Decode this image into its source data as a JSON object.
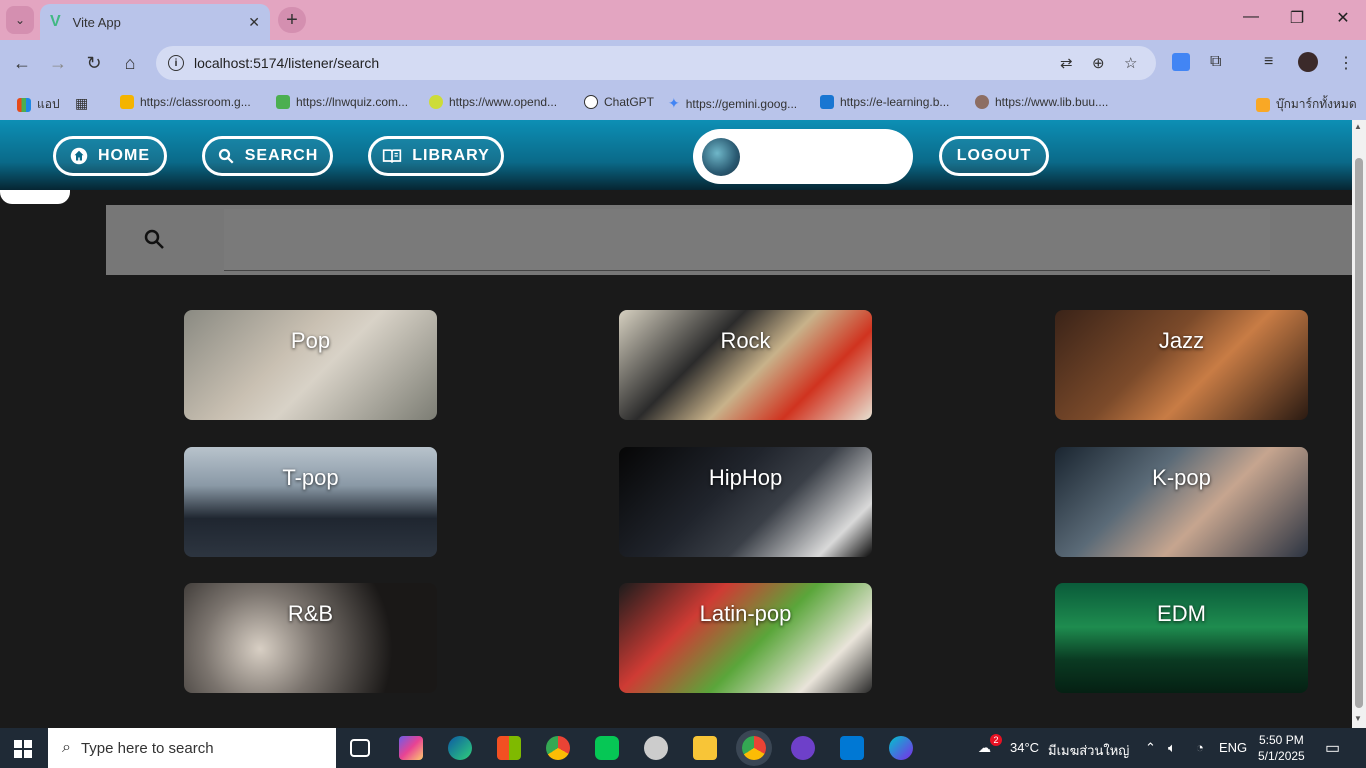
{
  "browser": {
    "tab_title": "Vite App",
    "url": "localhost:5174/listener/search",
    "bookmarks": [
      {
        "label": "แอป",
        "color": "#e64a19"
      },
      {
        "label": "https://classroom.g...",
        "color": "#f4b400"
      },
      {
        "label": "https://lnwquiz.com...",
        "color": "#4caf50"
      },
      {
        "label": "https://www.opend...",
        "color": "#cddc39"
      },
      {
        "label": "ChatGPT",
        "color": "#ffffff"
      },
      {
        "label": "https://gemini.goog...",
        "color": "#4285f4"
      },
      {
        "label": "https://e-learning.b...",
        "color": "#1976d2"
      },
      {
        "label": "https://www.lib.buu....",
        "color": "#8d6e63"
      },
      {
        "label": "บุ๊กมาร์กทั้งหมด",
        "color": "#f9a825"
      }
    ]
  },
  "nav": {
    "home": "HOME",
    "search": "SEARCH",
    "library": "LIBRARY",
    "logout": "LOGOUT"
  },
  "search": {
    "placeholder": ""
  },
  "genres": [
    {
      "label": "Pop",
      "bg": "linear-gradient(135deg,#8a8a82 0%,#c9c0b2 40%,#d8d2c7 55%,#7c7d74 100%)"
    },
    {
      "label": "Rock",
      "bg": "linear-gradient(135deg,#d6d0c0 0%,#2b2b2b 35%,#c8b28a 55%,#d0331f 75%,#e7e0d1 100%)"
    },
    {
      "label": "Jazz",
      "bg": "linear-gradient(135deg,#3a2318 0%,#7b4a2a 40%,#c87c45 60%,#2a1a12 100%)"
    },
    {
      "label": "T-pop",
      "bg": "linear-gradient(180deg,#b8c3cc 0%,#8a99a6 35%,#1f2630 65%,#2d3540 100%)"
    },
    {
      "label": "HipHop",
      "bg": "linear-gradient(135deg,#060606 0%,#20242c 40%,#3a3f47 60%,#d9d9d9 85%,#0a0a0a 100%)"
    },
    {
      "label": "K-pop",
      "bg": "linear-gradient(135deg,#1a2530 0%,#5a6a77 35%,#c6a58f 60%,#2c3442 100%)"
    },
    {
      "label": "R&B",
      "bg": "radial-gradient(circle at 30% 60%,#d8cfc4 0%,#7b746e 30%,#1a1817 70%)"
    },
    {
      "label": "Latin-pop",
      "bg": "linear-gradient(135deg,#1c1c1c 0%,#cf3b34 30%,#5aa63a 55%,#e9e4da 80%,#2a2a2a 100%)"
    },
    {
      "label": "EDM",
      "bg": "linear-gradient(180deg,#0a5b3a 0%,#1e8c4f 40%,#0a3a22 70%,#052013 100%)"
    }
  ],
  "taskbar": {
    "search_placeholder": "Type here to search",
    "weather": "34°C",
    "weather_text": "มีเมฆส่วนใหญ่",
    "lang": "ENG",
    "time": "5:50 PM",
    "date": "5/1/2025",
    "weather_badge": "2"
  }
}
